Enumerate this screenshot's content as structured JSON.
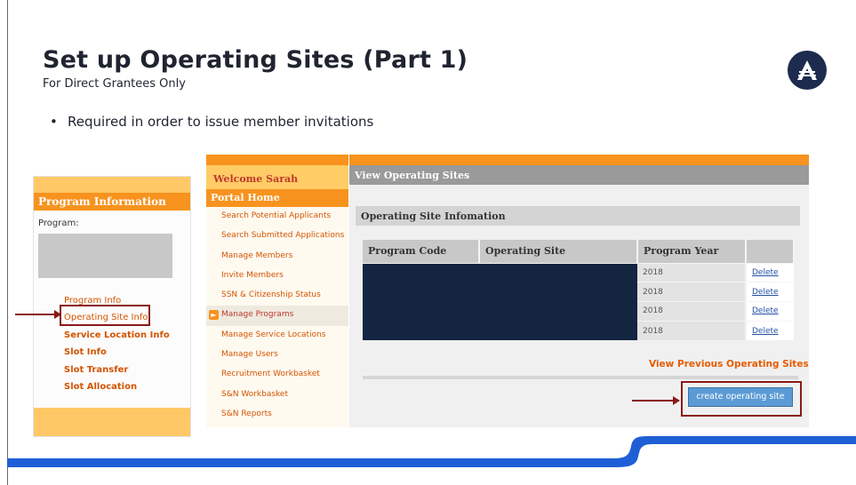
{
  "slide": {
    "banner_fragment": "Set up Operating Sites (Part 1)",
    "title": "Set up Operating Sites (Part 1)",
    "subtitle": "For Direct Grantees Only",
    "bullet": "Required in order to issue member invitations"
  },
  "left_panel": {
    "header": "Program Information",
    "program_label": "Program:",
    "links": [
      {
        "label": "Program Info",
        "bold": false
      },
      {
        "label": "Operating Site Info",
        "bold": false
      },
      {
        "label": "Service Location Info",
        "bold": true
      },
      {
        "label": "Slot Info",
        "bold": true
      },
      {
        "label": "Slot Transfer",
        "bold": true
      },
      {
        "label": "Slot Allocation",
        "bold": true
      }
    ]
  },
  "mid_nav": {
    "welcome": "Welcome Sarah",
    "home": "Portal Home",
    "items": [
      "Search Potential Applicants",
      "Search Submitted Applications",
      "Manage Members",
      "Invite Members",
      "SSN & Citizenship Status",
      "Manage Programs",
      "Manage Service Locations",
      "Manage Users",
      "Recruitment Workbasket",
      "S&N Workbasket",
      "S&N Reports"
    ],
    "active_item": "Manage Programs"
  },
  "main": {
    "bar_title": "View Operating Sites",
    "section_title": "Operating Site Infomation",
    "columns": [
      "Program Code",
      "Operating Site",
      "Program Year",
      ""
    ],
    "rows": [
      {
        "year": "2018",
        "action": "Delete"
      },
      {
        "year": "2018",
        "action": "Delete"
      },
      {
        "year": "2018",
        "action": "Delete"
      },
      {
        "year": "2018",
        "action": "Delete"
      }
    ],
    "view_previous": "View Previous Operating Sites",
    "create_button": "create operating site"
  },
  "colors": {
    "accent_orange": "#f7931e",
    "light_orange": "#ffc866",
    "highlight_box": "#8b1a1a",
    "footer_blue": "#1f5fd6",
    "redaction": "#132540"
  }
}
